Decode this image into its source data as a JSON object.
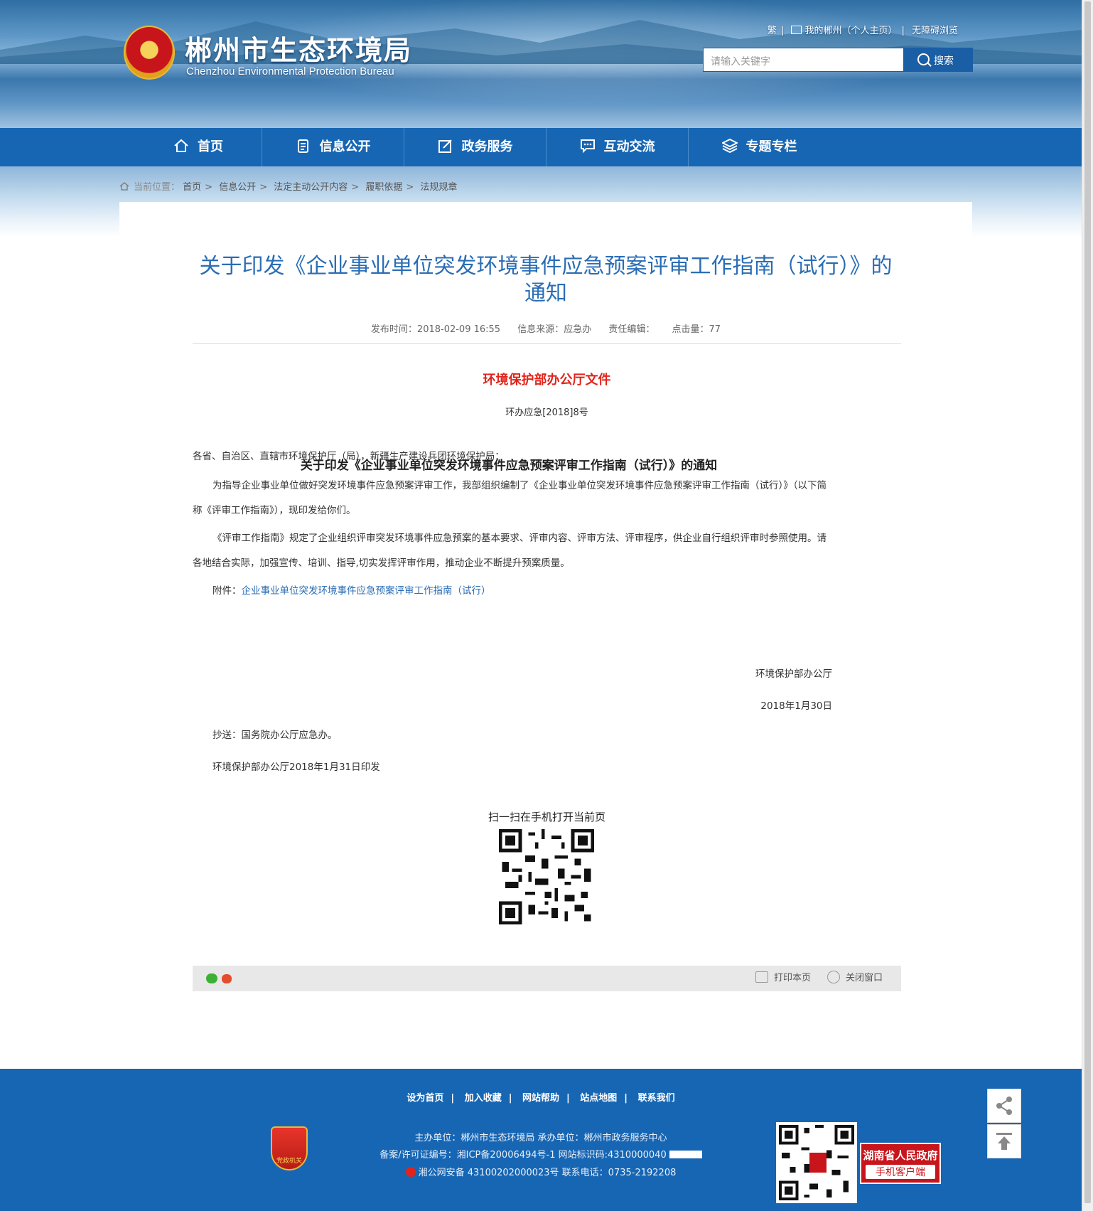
{
  "header": {
    "site_title": "郴州市生态环境局",
    "site_subtitle": "Chenzhou Environmental Protection Bureau",
    "top_links": {
      "traditional": "繁",
      "my_chenzhou": "我的郴州（个人主页）",
      "accessibility": "无障碍浏览"
    },
    "search": {
      "placeholder": "请输入关键字",
      "button": "搜索"
    }
  },
  "nav": {
    "items": [
      {
        "label": "首页",
        "icon": "home-icon"
      },
      {
        "label": "信息公开",
        "icon": "document-icon"
      },
      {
        "label": "政务服务",
        "icon": "edit-icon"
      },
      {
        "label": "互动交流",
        "icon": "chat-icon"
      },
      {
        "label": "专题专栏",
        "icon": "layers-icon"
      }
    ]
  },
  "breadcrumb": {
    "label": "当前位置：",
    "items": [
      "首页",
      "信息公开",
      "法定主动公开内容",
      "履职依据",
      "法规规章"
    ]
  },
  "article": {
    "title": "关于印发《企业事业单位突发环境事件应急预案评审工作指南（试行）》的通知",
    "meta": {
      "publish_time": "发布时间：2018-02-09 16:55",
      "source": "信息来源：应急办",
      "editor": "责任编辑：",
      "views": "点击量：77"
    },
    "doc_header": "环境保护部办公厅文件",
    "doc_number": "环办应急[2018]8号",
    "notice_title": "关于印发《企业事业单位突发环境事件应急预案评审工作指南（试行）》的通知",
    "recipients": "各省、自治区、直辖市环境保护厅（局），新疆生产建设兵团环境保护局：",
    "para1": "为指导企业事业单位做好突发环境事件应急预案评审工作，我部组织编制了《企业事业单位突发环境事件应急预案评审工作指南（试行）》（以下简称《评审工作指南》），现印发给你们。",
    "para2": "《评审工作指南》规定了企业组织评审突发环境事件应急预案的基本要求、评审内容、评审方法、评审程序，供企业自行组织评审时参照使用。请各地结合实际，加强宣传、培训、指导,切实发挥评审作用，推动企业不断提升预案质量。",
    "attachment_label": "附件：",
    "attachment_link": "企业事业单位突发环境事件应急预案评审工作指南（试行）",
    "signer": "环境保护部办公厅",
    "sign_date": "2018年1月30日",
    "cc": "抄送：国务院办公厅应急办。",
    "printed": "环境保护部办公厅2018年1月31日印发",
    "qr_caption": "扫一扫在手机打开当前页"
  },
  "share_bar": {
    "print": "打印本页",
    "close": "关闭窗口"
  },
  "footer": {
    "links": [
      "设为首页",
      "加入收藏",
      "网站帮助",
      "站点地图",
      "联系我们"
    ],
    "host": "主办单位：郴州市生态环境局   承办单位：郴州市政务服务中心",
    "icp": "备案/许可证编号：湘ICP备20006494号-1   网站标识码:4310000040",
    "police": "湘公网安备 43100202000023号   联系电话：0735-2192208",
    "party_badge": "党政机关",
    "app_line1": "湖南省人民政府",
    "app_line2": "手机客户端"
  },
  "colors": {
    "brand_blue": "#1766b4",
    "title_blue": "#2a6db5",
    "doc_red": "#e2231a"
  }
}
